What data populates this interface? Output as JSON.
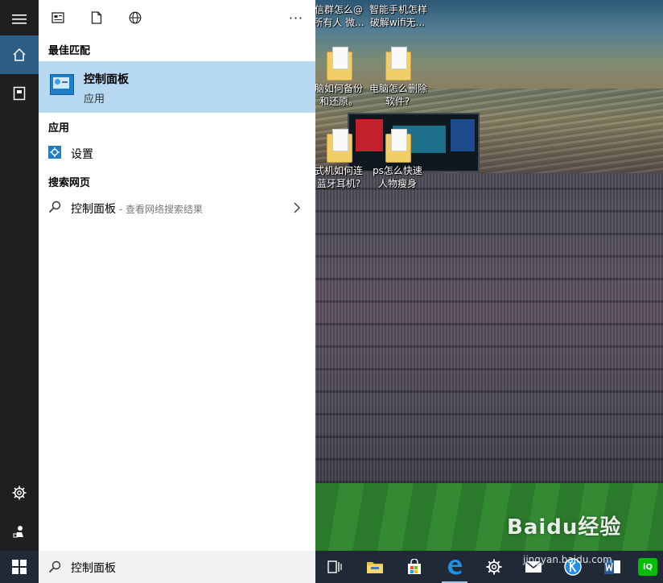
{
  "start_menu": {
    "best_match_header": "最佳匹配",
    "best_match": {
      "title": "控制面板",
      "subtitle": "应用",
      "icon": "control-panel-icon"
    },
    "apps_header": "应用",
    "apps": [
      {
        "label": "设置",
        "icon": "gear-icon"
      }
    ],
    "web_header": "搜索网页",
    "web": [
      {
        "query": "控制面板",
        "hint": " - 查看网络搜索结果",
        "icon": "search-icon"
      }
    ],
    "toolbar_icons": [
      "news-icon",
      "document-icon",
      "globe-icon",
      "more-icon"
    ],
    "more_label": "···"
  },
  "rail": {
    "items": [
      "menu-icon",
      "home-icon",
      "notebook-icon",
      "settings-icon",
      "feedback-icon"
    ]
  },
  "taskbar": {
    "search_text": "控制面板",
    "icons": [
      "task-view-icon",
      "file-explorer-icon",
      "store-icon",
      "edge-icon",
      "settings-icon",
      "mail-icon",
      "kugou-icon",
      "word-icon",
      "iqiyi-icon"
    ]
  },
  "desktop": {
    "icons": [
      {
        "label_line1": "信群怎么@",
        "label_line2": "所有人 微..."
      },
      {
        "label_line1": "智能手机怎样",
        "label_line2": "破解wifi无..."
      },
      {
        "label_line1": "脑如何备份",
        "label_line2": "和还原。"
      },
      {
        "label_line1": "电脑怎么删除",
        "label_line2": "软件?"
      },
      {
        "label_line1": "式机如何连",
        "label_line2": "蓝牙耳机?"
      },
      {
        "label_line1": "ps怎么快速",
        "label_line2": "人物瘦身"
      }
    ],
    "watermark": "Baidu经验",
    "watermark_url": "jingyan.baidu.com"
  }
}
